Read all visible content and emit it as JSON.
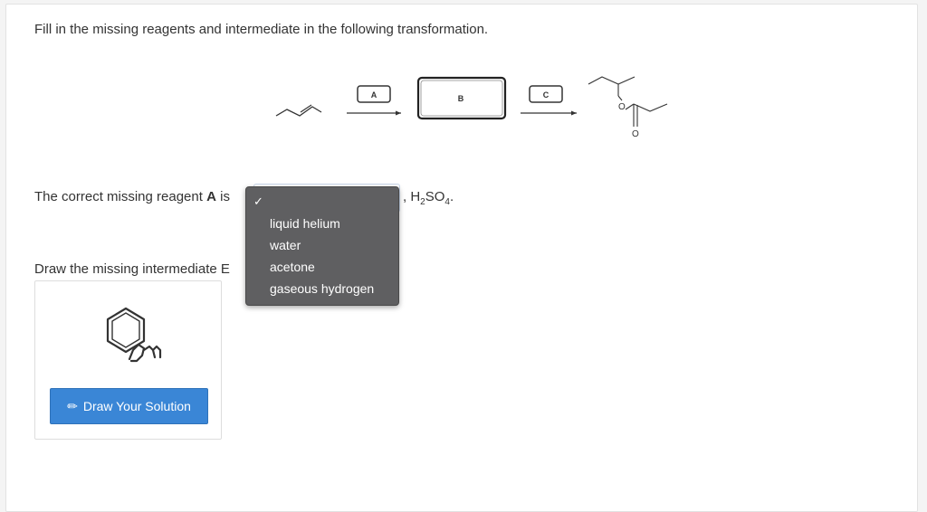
{
  "question": {
    "prompt": "Fill in the missing reagents and intermediate in the following transformation."
  },
  "scheme": {
    "label_a": "A",
    "label_b": "B",
    "label_c": "C"
  },
  "reagent_a": {
    "prefix": "The correct missing reagent",
    "bold": "A",
    "suffix_is": "is",
    "after_select": ", H",
    "subscript": "2",
    "after_sub": "SO",
    "subscript2": "4",
    "end": "."
  },
  "dropdown": {
    "check": "✓",
    "options": [
      "liquid helium",
      "water",
      "acetone",
      "gaseous hydrogen"
    ]
  },
  "intermediate_b": {
    "prompt": "Draw the missing intermediate E"
  },
  "draw_button": {
    "label": "Draw Your Solution",
    "icon": "pencil-icon"
  },
  "colors": {
    "button_blue": "#3a86d6",
    "dropdown_bg": "#5f5f61"
  }
}
